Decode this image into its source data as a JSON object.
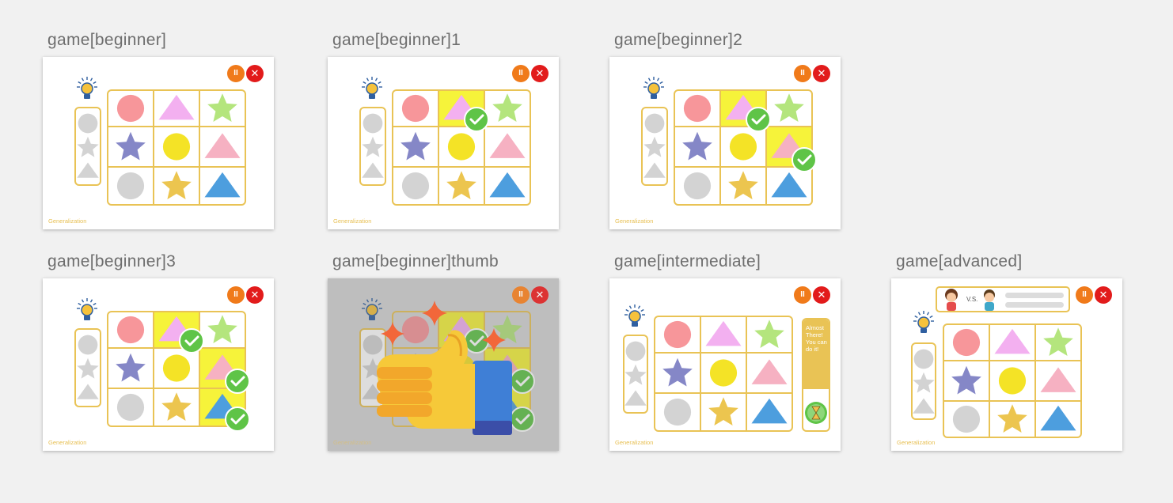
{
  "artboards": [
    {
      "title": "game[beginner]",
      "footer": "Generalization"
    },
    {
      "title": "game[beginner]1",
      "footer": "Generalization"
    },
    {
      "title": "game[beginner]2",
      "footer": "Generalization"
    },
    {
      "title": "game[beginner]3",
      "footer": "Generalization"
    },
    {
      "title": "game[beginner]thumb",
      "footer": "Generalization"
    },
    {
      "title": "game[intermediate]",
      "footer": "Generalization",
      "hint": "Almost There! You can do it!"
    },
    {
      "title": "game[advanced]",
      "footer": "Generalization",
      "vs": "V.S."
    }
  ],
  "controls": {
    "pause_icon": "pause-icon",
    "close_icon": "close-icon",
    "pause_glyph": "II",
    "close_glyph": "✕"
  },
  "colors": {
    "background": "#f1f1f1",
    "grid_border": "#e9c355",
    "highlight": "#f6f33a",
    "check": "#5fc447",
    "pink": "#f7969a",
    "violet": "#f3b0f0",
    "green": "#b4e57d",
    "navy": "#8587c7",
    "yellow": "#f4e326",
    "rose": "#f6b1c2",
    "gray": "#d3d3d3",
    "gold": "#ecc54f",
    "blue": "#4d9ede"
  }
}
